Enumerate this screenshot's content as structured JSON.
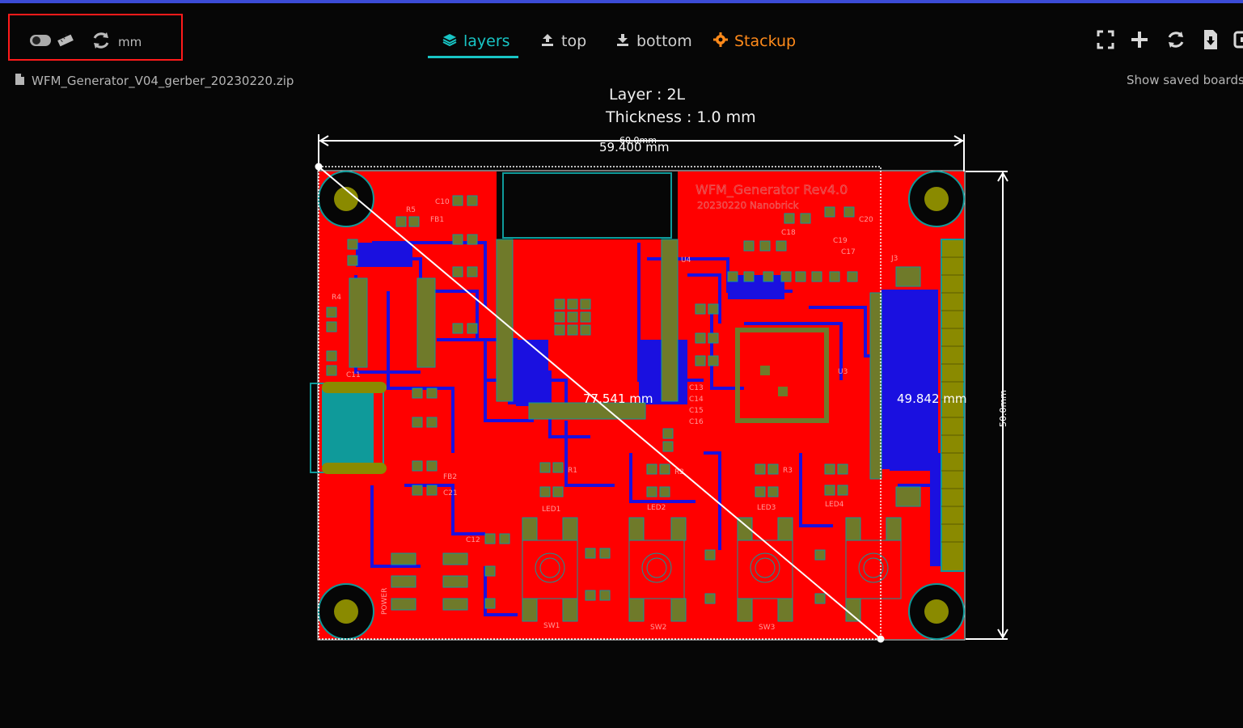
{
  "app": {
    "unit": "mm",
    "file_name": "WFM_Generator_V04_gerber_20230220.zip",
    "saved_boards_label": "Show saved boards"
  },
  "tabs": [
    {
      "label": "layers",
      "icon": "layers-icon",
      "active": true
    },
    {
      "label": "top",
      "icon": "upload-icon",
      "active": false
    },
    {
      "label": "bottom",
      "icon": "download-icon",
      "active": false
    },
    {
      "label": "Stackup",
      "icon": "gear-icon",
      "active": false
    }
  ],
  "board_info": {
    "layer_label": "Layer : 2L",
    "thickness_label": "Thickness : 1.0 mm"
  },
  "measurements": {
    "width_dim": "60.0mm",
    "measure_width": "59.400 mm",
    "diagonal": "77.541 mm",
    "measure_height": "49.842 mm",
    "height_dim": "50.0mm"
  },
  "silkscreen": {
    "title": "WFM_Generator Rev4.0",
    "subtitle": "20230220  Nanobrick",
    "labels": [
      "SW1",
      "SW2",
      "SW3",
      "LED1",
      "LED2",
      "LED3",
      "LED4",
      "POWER",
      "U3",
      "U4",
      "J3",
      "FB1",
      "FB2",
      "C10",
      "C11",
      "C12",
      "C13",
      "C14",
      "C15",
      "C16",
      "C17",
      "C18",
      "C19",
      "C20",
      "C21",
      "R1",
      "R2",
      "R3",
      "R4",
      "R5"
    ]
  },
  "colors": {
    "accent": "#18c5c5",
    "stackup": "#ff8a1a",
    "board_top": "#ff0000",
    "trace_bottom": "#1a10e0",
    "pad": "#6f7a2a",
    "copper_outline": "#0f9a9a",
    "highlight_border": "#ff1a1a"
  }
}
